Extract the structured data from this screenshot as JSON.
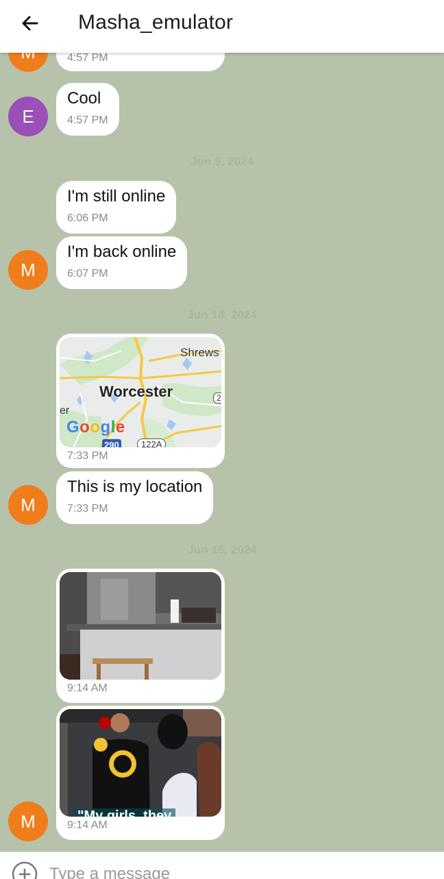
{
  "header": {
    "title": "Masha_emulator",
    "back_icon": "arrow-left-icon"
  },
  "colors": {
    "chat_background": "#b6c3aa",
    "avatar_m": "#f07d1c",
    "avatar_e": "#9b4fb8"
  },
  "messages": [
    {
      "type": "text",
      "text": "",
      "time": "4:57 PM",
      "avatar": "M"
    },
    {
      "type": "text",
      "text": "Cool",
      "time": "4:57 PM",
      "avatar": "E"
    },
    {
      "type": "date",
      "label": "Jun 9, 2024"
    },
    {
      "type": "text",
      "text": "I'm still online",
      "time": "6:06 PM"
    },
    {
      "type": "text",
      "text": "I'm back online",
      "time": "6:07 PM",
      "avatar": "M"
    },
    {
      "type": "date",
      "label": "Jun 14, 2024"
    },
    {
      "type": "location",
      "time": "7:33 PM",
      "map": {
        "city": "Worcester",
        "place_partial_1": "Shrews",
        "place_partial_2": "er",
        "route_1": "290",
        "route_2": "122A",
        "route_3": "2",
        "logo": "Google"
      }
    },
    {
      "type": "text",
      "text": "This is my location",
      "time": "7:33 PM",
      "avatar": "M"
    },
    {
      "type": "date",
      "label": "Jun 15, 2024"
    },
    {
      "type": "image",
      "time": "9:14 AM",
      "icon": "kitchen-photo"
    },
    {
      "type": "video",
      "time": "9:14 AM",
      "caption": "\"My girls, they",
      "avatar": "M"
    }
  ],
  "composer": {
    "placeholder": "Type a message",
    "attach_icon": "plus-circle-icon"
  }
}
